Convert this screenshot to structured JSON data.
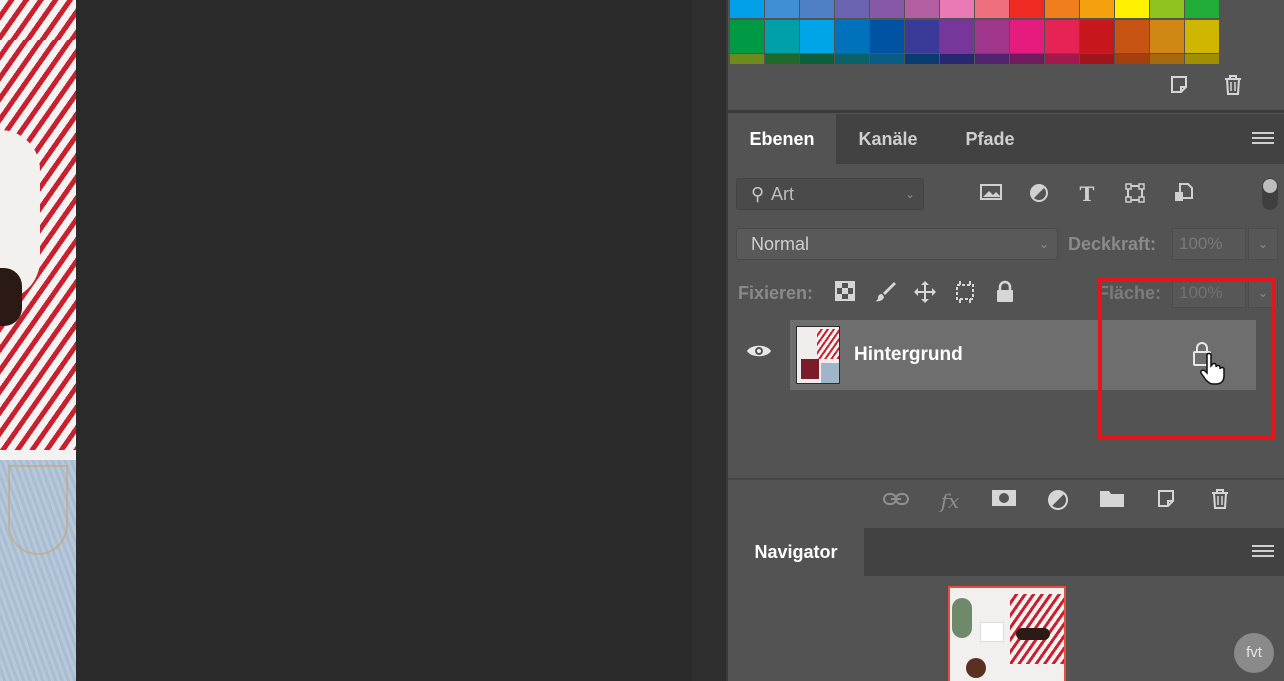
{
  "swatches": {
    "row1": [
      "#00a0e9",
      "#3f8fd5",
      "#4f7fc4",
      "#6a64b0",
      "#8659a7",
      "#b45fa3",
      "#e97ab5",
      "#ef6f7e",
      "#ef2a23",
      "#f07e1c",
      "#f5a00e",
      "#fff100",
      "#8fc31f",
      "#22ac38"
    ],
    "row2": [
      "#009944",
      "#00a0a9",
      "#00a5e8",
      "#0072bc",
      "#0052a3",
      "#3a3b98",
      "#77379a",
      "#9f368c",
      "#e61b7e",
      "#e52354",
      "#c8161d",
      "#c85413",
      "#d08713",
      "#cfb600"
    ],
    "row3": [
      "#6f8a1c",
      "#1f6a2a",
      "#0a5e3a",
      "#0a6168",
      "#0a5c84",
      "#0a3b6e",
      "#282772",
      "#52246f",
      "#6e1c5e",
      "#a3184d",
      "#a0141b",
      "#a43f10",
      "#a56a10",
      "#a08f00"
    ]
  },
  "icons": {
    "new_swatch": "new-swatch-icon",
    "delete_swatch": "trash-icon"
  },
  "layers_panel": {
    "tabs": [
      "Ebenen",
      "Kanäle",
      "Pfade"
    ],
    "active_tab": "Ebenen",
    "filter": {
      "label": "Art"
    },
    "blend_mode": "Normal",
    "opacity_label": "Deckkraft:",
    "opacity_value": "100%",
    "lock_label": "Fixieren:",
    "fill_label": "Fläche:",
    "fill_value": "100%",
    "layers": [
      {
        "name": "Hintergrund",
        "visible": true,
        "locked": true
      }
    ],
    "footer_fx": "fx"
  },
  "navigator": {
    "tab": "Navigator"
  },
  "watermark": "fvt",
  "colors": {
    "highlight": "#e8141b",
    "panel": "#535353",
    "tab_bar": "#424242"
  }
}
